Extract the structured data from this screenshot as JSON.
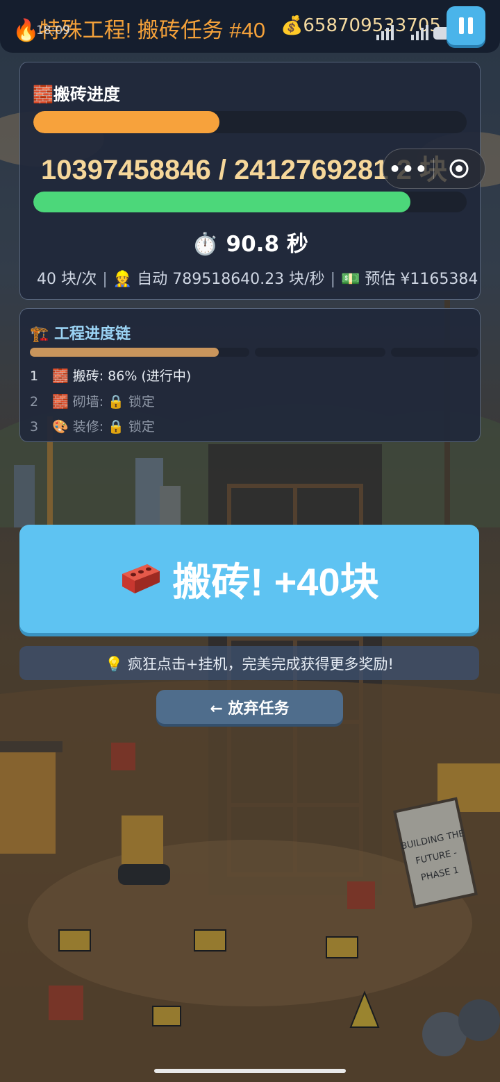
{
  "header": {
    "title": "🔥特殊工程! 搬砖任务 #40",
    "coins": "💰658709533705",
    "status_time": "18:09"
  },
  "progress_panel": {
    "heading": "🧱搬砖进度",
    "count": "10397458846 / 2412769281 2 块",
    "orange_fraction": 0.43,
    "green_fraction": 0.87,
    "timer": "⏱️ 90.8 秒",
    "stats": {
      "per_click": "40 块/次",
      "auto": "👷 自动 789518640.23 块/秒",
      "estimate": "💵 预估 ¥1165384"
    }
  },
  "mini_menu": {
    "more": "•••"
  },
  "chain_panel": {
    "heading": "🏗️ 工程进度链",
    "first_segment_fraction": 0.86,
    "items": [
      {
        "num": "1",
        "text": "🧱 搬砖: 86% (进行中)"
      },
      {
        "num": "2",
        "text": "🧱 砌墙: 🔒 锁定"
      },
      {
        "num": "3",
        "text": "🎨 装修: 🔒 锁定"
      }
    ]
  },
  "main_button": {
    "icon": "🧱",
    "label": "搬砖! +40块"
  },
  "tip": "💡 疯狂点击+挂机，完美完成获得更多奖励!",
  "back_button": "← 放弃任务",
  "colors": {
    "title": "#f4a13a",
    "orange_bar": "#f7a23c",
    "green_bar": "#4cd77a",
    "chain_active": "#c9955c",
    "main_button": "#5ec3f2"
  }
}
